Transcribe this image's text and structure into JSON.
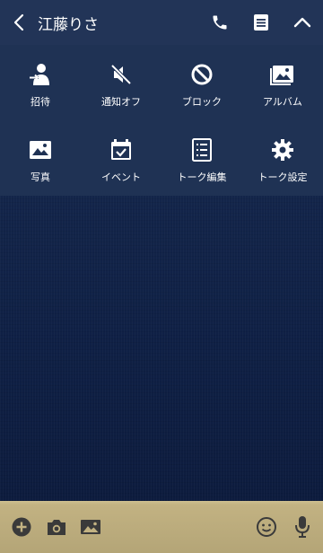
{
  "header": {
    "title": "江藤りさ",
    "back_icon": "chevron-left-icon",
    "call_icon": "phone-icon",
    "notes_icon": "note-icon",
    "collapse_icon": "chevron-up-icon"
  },
  "menu": {
    "items": [
      {
        "label": "招待",
        "icon": "invite-person-icon"
      },
      {
        "label": "通知オフ",
        "icon": "speaker-muted-icon"
      },
      {
        "label": "ブロック",
        "icon": "block-icon"
      },
      {
        "label": "アルバム",
        "icon": "album-icon"
      },
      {
        "label": "写真",
        "icon": "photo-icon"
      },
      {
        "label": "イベント",
        "icon": "calendar-check-icon"
      },
      {
        "label": "トーク編集",
        "icon": "list-edit-icon"
      },
      {
        "label": "トーク設定",
        "icon": "gear-icon"
      }
    ]
  },
  "input_bar": {
    "icons": [
      "plus-circle-icon",
      "camera-icon",
      "image-icon",
      "smiley-icon",
      "microphone-icon"
    ]
  },
  "colors": {
    "header_bg": "#223457",
    "menu_bg": "#1f3254",
    "chat_bg": "#0f2045",
    "input_bar_bg": "#c2b282",
    "icon_white": "#ffffff"
  }
}
